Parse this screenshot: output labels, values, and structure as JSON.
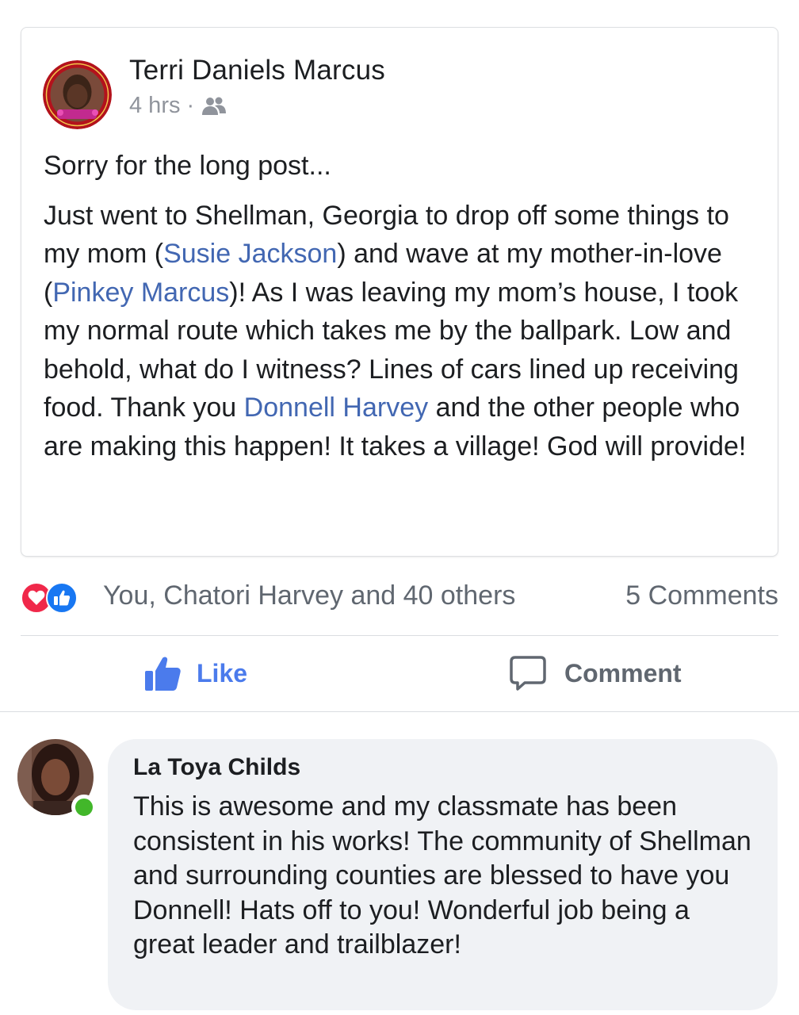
{
  "post": {
    "author": "Terri Daniels Marcus",
    "time": "4 hrs",
    "separator": "·",
    "audience_icon": "friends-icon",
    "intro": "Sorry for the long post...",
    "body_parts": [
      {
        "text": "Just went to Shellman, Georgia to drop off some things to my mom (",
        "link": false
      },
      {
        "text": "Susie Jackson",
        "link": true
      },
      {
        "text": ") and wave at my mother-in-love (",
        "link": false
      },
      {
        "text": "Pinkey Marcus",
        "link": true
      },
      {
        "text": ")! As I was leaving my mom’s house, I took my normal route which takes me by the ballpark. Low and behold, what do I witness? Lines of cars lined up receiving food. Thank you ",
        "link": false
      },
      {
        "text": "Donnell Harvey",
        "link": true
      },
      {
        "text": " and the other people who are making this happen! It takes a village! God will provide!",
        "link": false
      }
    ],
    "reactions_text": "You, Chatori Harvey and 40 others",
    "comments_count": "5 Comments",
    "reaction_icons": [
      "love-icon",
      "like-icon"
    ]
  },
  "actions": {
    "like_label": "Like",
    "comment_label": "Comment"
  },
  "comment": {
    "author": "La Toya Childs",
    "text": "This is awesome and my classmate has been consistent in his works! The community of Shellman and surrounding counties are blessed to have you Donnell! Hats off to you! Wonderful job being a great leader and trailblazer!",
    "online": true
  },
  "colors": {
    "link": "#4267b2",
    "like_action": "#4b7bec",
    "love": "#f0284a",
    "like_badge": "#1877f2",
    "online": "#42b72a",
    "bubble": "#f0f2f5"
  }
}
